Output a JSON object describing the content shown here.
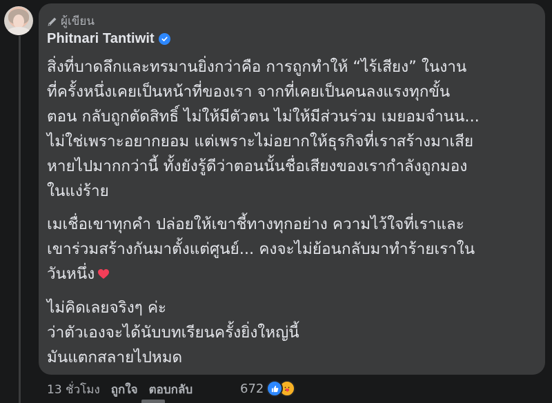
{
  "comment": {
    "author_tag": "ผู้เขียน",
    "author_name": "Phitnari Tantiwit",
    "verified": true,
    "paragraphs": [
      [
        "สิ่งที่บาดลึกและทรมานยิ่งกว่าคือ การถูกทำให้ “ไร้เสียง” ในงาน",
        "ที่ครั้งหนึ่งเคยเป็นหน้าที่ของเรา จากที่เคยเป็นคนลงแรงทุกขั้น",
        "ตอน กลับถูกตัดสิทธิ์ ไม่ให้มีตัวตน ไม่ให้มีส่วนร่วม เมยอมจำนน...",
        "ไม่ใช่เพราะอยากยอม แต่เพราะไม่อยากให้ธุรกิจที่เราสร้างมาเสีย",
        "หายไปมากกว่านี้ ทั้งยังรู้ดีว่าตอนนั้นชื่อเสียงของเรากำลังถูกมอง",
        "ในแง่ร้าย"
      ],
      [
        "เมเชื่อเขาทุกคำ ปล่อยให้เขาชี้ทางทุกอย่าง ความไว้ใจที่เราและ",
        "เขาร่วมสร้างกันมาตั้งแต่ศูนย์... คงจะไม่ย้อนกลับมาทำร้ายเราใน",
        "วันหนึ่ง"
      ],
      [
        "ไม่คิดเลยจริงๆ ค่ะ",
        "ว่าตัวเองจะได้นับบทเรียนครั้งยิ่งใหญ่นี้",
        "มันแตกสลายไปหมด"
      ]
    ]
  },
  "actions": {
    "time": "13 ชั่วโมง",
    "like_label": "ถูกใจ",
    "reply_label": "ตอบกลับ",
    "reaction_count": "672",
    "reactions": [
      "like-icon",
      "care-icon"
    ]
  },
  "colors": {
    "background": "#18191a",
    "bubble": "#3a3b3c",
    "text_primary": "#e4e6eb",
    "text_secondary": "#b0b3b8",
    "verified_blue": "#2d88ff",
    "heart_red": "#f33e58"
  }
}
